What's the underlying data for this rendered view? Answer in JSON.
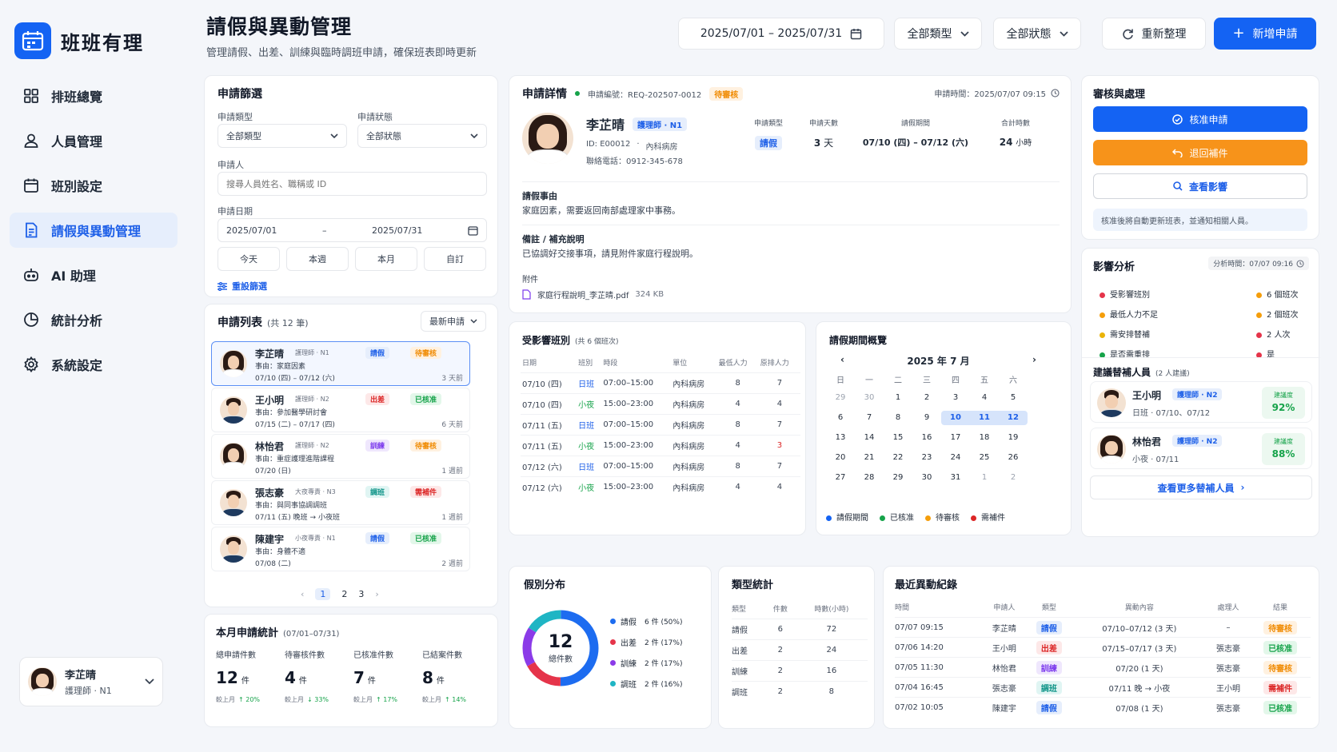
{
  "app": {
    "name": "班班有理"
  },
  "nav": [
    {
      "label": "排班總覽",
      "icon": "grid-icon"
    },
    {
      "label": "人員管理",
      "icon": "user-icon"
    },
    {
      "label": "班別設定",
      "icon": "calendar-icon"
    },
    {
      "label": "請假與異動管理",
      "icon": "document-icon",
      "active": true
    },
    {
      "label": "AI 助理",
      "icon": "robot-icon"
    },
    {
      "label": "統計分析",
      "icon": "pie-chart-icon"
    },
    {
      "label": "系統設定",
      "icon": "gear-icon"
    }
  ],
  "current_user": {
    "name": "李芷晴",
    "role": "護理師 · N1"
  },
  "header": {
    "title": "請假與異動管理",
    "subtitle": "管理請假、出差、訓練與臨時調班申請，確保班表即時更新",
    "date_range": "2025/07/01 – 2025/07/31",
    "type_filter": "全部類型",
    "status_filter": "全部狀態",
    "refresh": "重新整理",
    "new_request": "新增申請"
  },
  "filter": {
    "title": "申請篩選",
    "type_label": "申請類型",
    "type_value": "全部類型",
    "status_label": "申請狀態",
    "status_value": "全部狀態",
    "applicant_label": "申請人",
    "applicant_placeholder": "搜尋人員姓名、職稱或 ID",
    "date_label": "申請日期",
    "date_from": "2025/07/01",
    "date_sep": "–",
    "date_to": "2025/07/31",
    "quick": [
      "今天",
      "本週",
      "本月",
      "自訂"
    ],
    "reset": "重設篩選"
  },
  "list": {
    "title": "申請列表",
    "count": "(共 12 筆)",
    "sort": "最新申請",
    "items": [
      {
        "name": "李芷晴",
        "role": "護理師 · N1",
        "type": "請假",
        "type_color": "blue",
        "status": "待審核",
        "status_color": "orange",
        "reason": "事由：家庭因素",
        "dates": "07/10 (四) – 07/12 (六)",
        "ago": "3 天前",
        "gender": "f"
      },
      {
        "name": "王小明",
        "role": "護理師 · N2",
        "type": "出差",
        "type_color": "red",
        "status": "已核准",
        "status_color": "green",
        "reason": "事由：參加醫學研討會",
        "dates": "07/15 (二) – 07/17 (四)",
        "ago": "6 天前",
        "gender": "m"
      },
      {
        "name": "林怡君",
        "role": "護理師 · N2",
        "type": "訓練",
        "type_color": "purple",
        "status": "待審核",
        "status_color": "orange",
        "reason": "事由：重症護理進階課程",
        "dates": "07/20 (日)",
        "ago": "1 週前",
        "gender": "f"
      },
      {
        "name": "張志豪",
        "role": "大夜專責 · N3",
        "type": "調班",
        "type_color": "teal",
        "status": "需補件",
        "status_color": "red",
        "reason": "事由：與同事協調調班",
        "dates": "07/11 (五) 晚班 → 小夜班",
        "ago": "1 週前",
        "gender": "m"
      },
      {
        "name": "陳建宇",
        "role": "小夜專責 · N1",
        "type": "請假",
        "type_color": "blue",
        "status": "已核准",
        "status_color": "green",
        "reason": "事由：身體不適",
        "dates": "07/08 (二)",
        "ago": "2 週前",
        "gender": "m"
      }
    ],
    "pages": [
      "1",
      "2",
      "3"
    ]
  },
  "monthly": {
    "title": "本月申請統計",
    "range": "(07/01–07/31)",
    "stats": [
      {
        "label": "總申請件數",
        "value": "12",
        "unit": "件",
        "cmp": "較上月",
        "delta": "↑ 20%"
      },
      {
        "label": "待審核件數",
        "value": "4",
        "unit": "件",
        "cmp": "較上月",
        "delta": "↓ 33%"
      },
      {
        "label": "已核准件數",
        "value": "7",
        "unit": "件",
        "cmp": "較上月",
        "delta": "↑ 17%"
      },
      {
        "label": "已結案件數",
        "value": "8",
        "unit": "件",
        "cmp": "較上月",
        "delta": "↑ 14%"
      }
    ]
  },
  "detail": {
    "title": "申請詳情",
    "req_no": "申請編號：REQ-202507-0012",
    "status": "待審核",
    "req_time": "申請時間：2025/07/07 09:15",
    "name": "李芷晴",
    "role": "護理師 · N1",
    "id_line": "ID: E00012",
    "dept": "內科病房",
    "phone": "聯絡電話：0912-345-678",
    "summary_labels": [
      "申請類型",
      "申請天數",
      "請假期間",
      "合計時數"
    ],
    "summary_type": "請假",
    "summary_days": "3",
    "summary_days_unit": "天",
    "summary_period": "07/10 (四) – 07/12 (六)",
    "summary_hours": "24",
    "summary_hours_unit": "小時",
    "reason_label": "請假事由",
    "reason": "家庭因素，需要返回南部處理家中事務。",
    "note_label": "備註 / 補充說明",
    "note": "已協調好交接事項，請見附件家庭行程說明。",
    "attach_label": "附件",
    "attach_name": "家庭行程說明_李芷晴.pdf",
    "attach_size": "324 KB"
  },
  "shifts": {
    "title": "受影響班別",
    "count": "(共 6 個班次)",
    "headers": [
      "日期",
      "班別",
      "時段",
      "單位",
      "最低人力",
      "原排人力"
    ],
    "rows": [
      [
        "07/10 (四)",
        "日班",
        "07:00–15:00",
        "內科病房",
        "8",
        "7"
      ],
      [
        "07/10 (四)",
        "小夜",
        "15:00–23:00",
        "內科病房",
        "4",
        "4"
      ],
      [
        "07/11 (五)",
        "日班",
        "07:00–15:00",
        "內科病房",
        "8",
        "7"
      ],
      [
        "07/11 (五)",
        "小夜",
        "15:00–23:00",
        "內科病房",
        "4",
        "3"
      ],
      [
        "07/12 (六)",
        "日班",
        "07:00–15:00",
        "內科病房",
        "8",
        "7"
      ],
      [
        "07/12 (六)",
        "小夜",
        "15:00–23:00",
        "內科病房",
        "4",
        "4"
      ]
    ]
  },
  "calendar": {
    "title": "請假期間概覽",
    "month": "2025 年 7 月",
    "weekdays": [
      "日",
      "一",
      "二",
      "三",
      "四",
      "五",
      "六"
    ],
    "weeks": [
      [
        "29",
        "30",
        "1",
        "2",
        "3",
        "4",
        "5"
      ],
      [
        "6",
        "7",
        "8",
        "9",
        "10",
        "11",
        "12"
      ],
      [
        "13",
        "14",
        "15",
        "16",
        "17",
        "18",
        "19"
      ],
      [
        "20",
        "21",
        "22",
        "23",
        "24",
        "25",
        "26"
      ],
      [
        "27",
        "28",
        "29",
        "30",
        "31",
        "1",
        "2"
      ]
    ],
    "legend": [
      {
        "label": "請假期間",
        "color": "#1463f3"
      },
      {
        "label": "已核准",
        "color": "#16a34a"
      },
      {
        "label": "待審核",
        "color": "#f59e0b"
      },
      {
        "label": "需補件",
        "color": "#dc2626"
      }
    ]
  },
  "review": {
    "title": "審核與處理",
    "approve": "核准申請",
    "return": "退回補件",
    "impact": "查看影響",
    "note": "核准後將自動更新班表，並通知相關人員。"
  },
  "impact": {
    "title": "影響分析",
    "time": "分析時間：07/07 09:16",
    "items": [
      {
        "label": "受影響班別",
        "value": "6 個班次"
      },
      {
        "label": "最低人力不足",
        "value": "2 個班次"
      },
      {
        "label": "需安排替補",
        "value": "2 人次"
      },
      {
        "label": "是否需重排",
        "value": "是"
      }
    ],
    "sub_title": "建議替補人員",
    "sub_count": "(2 人建議)",
    "subs": [
      {
        "name": "王小明",
        "role": "護理師 · N2",
        "shift": "日班 · 07/10、07/12",
        "fit_label": "建議度",
        "fit": "92%"
      },
      {
        "name": "林怡君",
        "role": "護理師 · N2",
        "shift": "小夜 · 07/11",
        "fit_label": "建議度",
        "fit": "88%"
      }
    ],
    "more": "查看更多替補人員"
  },
  "dist": {
    "title": "假別分布",
    "center_value": "12",
    "center_label": "總件數",
    "items": [
      {
        "label": "請假",
        "value": "6 件 (50%)",
        "color": "#1d6cf0"
      },
      {
        "label": "出差",
        "value": "2 件 (17%)",
        "color": "#e5344a"
      },
      {
        "label": "訓練",
        "value": "2 件 (17%)",
        "color": "#8b3be8"
      },
      {
        "label": "調班",
        "value": "2 件 (16%)",
        "color": "#1fb5c4"
      }
    ]
  },
  "chart_data": {
    "type": "pie",
    "categories": [
      "請假",
      "出差",
      "訓練",
      "調班"
    ],
    "values": [
      50,
      17,
      17,
      16
    ]
  },
  "typestat": {
    "title": "類型統計",
    "headers": [
      "類型",
      "件數",
      "時數(小時)"
    ],
    "rows": [
      [
        "請假",
        "6",
        "72"
      ],
      [
        "出差",
        "2",
        "24"
      ],
      [
        "訓練",
        "2",
        "16"
      ],
      [
        "調班",
        "2",
        "8"
      ]
    ]
  },
  "recent": {
    "title": "最近異動紀錄",
    "headers": [
      "時間",
      "申請人",
      "類型",
      "異動內容",
      "處理人",
      "結果"
    ],
    "rows": [
      {
        "time": "07/07 09:15",
        "who": "李芷晴",
        "type": "請假",
        "tc": "blue",
        "content": "07/10–07/12 (3 天)",
        "handler": "–",
        "result": "待審核",
        "rc": "orange"
      },
      {
        "time": "07/06 14:20",
        "who": "王小明",
        "type": "出差",
        "tc": "red",
        "content": "07/15–07/17 (3 天)",
        "handler": "張志豪",
        "result": "已核准",
        "rc": "green"
      },
      {
        "time": "07/05 11:30",
        "who": "林怡君",
        "type": "訓練",
        "tc": "purple",
        "content": "07/20 (1 天)",
        "handler": "張志豪",
        "result": "待審核",
        "rc": "orange"
      },
      {
        "time": "07/04 16:45",
        "who": "張志豪",
        "type": "調班",
        "tc": "teal",
        "content": "07/11 晚 → 小夜",
        "handler": "王小明",
        "result": "需補件",
        "rc": "red"
      },
      {
        "time": "07/02 10:05",
        "who": "陳建宇",
        "type": "請假",
        "tc": "blue",
        "content": "07/08 (1 天)",
        "handler": "張志豪",
        "result": "已核准",
        "rc": "green"
      }
    ]
  }
}
